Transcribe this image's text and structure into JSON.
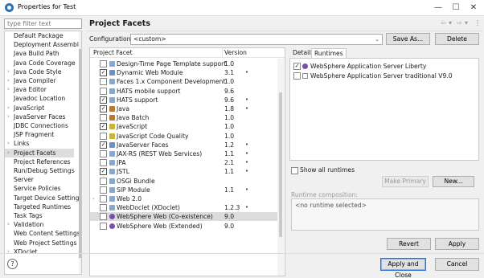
{
  "window": {
    "title": "Properties for Test",
    "minimize": "—",
    "maximize": "☐",
    "close": "✕"
  },
  "filter": {
    "placeholder": "type filter text"
  },
  "nav": [
    {
      "label": "Default Package",
      "chev": false
    },
    {
      "label": "Deployment Assembly",
      "chev": false
    },
    {
      "label": "Java Build Path",
      "chev": false
    },
    {
      "label": "Java Code Coverage",
      "chev": false
    },
    {
      "label": "Java Code Style",
      "chev": true
    },
    {
      "label": "Java Compiler",
      "chev": true
    },
    {
      "label": "Java Editor",
      "chev": true
    },
    {
      "label": "Javadoc Location",
      "chev": false
    },
    {
      "label": "JavaScript",
      "chev": true
    },
    {
      "label": "JavaServer Faces",
      "chev": true
    },
    {
      "label": "JDBC Connections",
      "chev": false
    },
    {
      "label": "JSP Fragment",
      "chev": false
    },
    {
      "label": "Links",
      "chev": true
    },
    {
      "label": "Project Facets",
      "chev": true,
      "selected": true
    },
    {
      "label": "Project References",
      "chev": false
    },
    {
      "label": "Run/Debug Settings",
      "chev": false
    },
    {
      "label": "Server",
      "chev": false
    },
    {
      "label": "Service Policies",
      "chev": false
    },
    {
      "label": "Target Device Settings",
      "chev": false
    },
    {
      "label": "Targeted Runtimes",
      "chev": false
    },
    {
      "label": "Task Tags",
      "chev": false
    },
    {
      "label": "Validation",
      "chev": true
    },
    {
      "label": "Web Content Settings",
      "chev": false
    },
    {
      "label": "Web Project Settings",
      "chev": false
    },
    {
      "label": "XDoclet",
      "chev": true
    }
  ],
  "header": {
    "title": "Project Facets",
    "back": "⇦",
    "back_dd": "▾",
    "fwd": "⇨",
    "fwd_dd": "▾",
    "menu": "⋮"
  },
  "config": {
    "label": "Configuration:",
    "value": "<custom>",
    "dd": "⌄",
    "save_as": "Save As...",
    "delete": "Delete"
  },
  "facets_table": {
    "col_facet": "Project Facet",
    "col_version": "Version",
    "rows": [
      {
        "name": "Design-Time Page Template support",
        "version": "1.0",
        "checked": false,
        "expand": false,
        "dot": false,
        "ico": "#8aa7c8"
      },
      {
        "name": "Dynamic Web Module",
        "version": "3.1",
        "checked": true,
        "expand": false,
        "dot": true,
        "ico": "#6f8fbf"
      },
      {
        "name": "Faces 1.x Component Development",
        "version": "1.0",
        "checked": false,
        "expand": false,
        "dot": false,
        "ico": "#8aa7c8"
      },
      {
        "name": "HATS mobile support",
        "version": "9.6",
        "checked": false,
        "expand": false,
        "dot": false,
        "ico": "#8aa7c8"
      },
      {
        "name": "HATS support",
        "version": "9.6",
        "checked": true,
        "expand": false,
        "dot": true,
        "ico": "#8aa7c8"
      },
      {
        "name": "Java",
        "version": "1.8",
        "checked": true,
        "expand": false,
        "dot": true,
        "ico": "#b37a3b"
      },
      {
        "name": "Java Batch",
        "version": "1.0",
        "checked": false,
        "expand": false,
        "dot": false,
        "ico": "#b37a3b"
      },
      {
        "name": "JavaScript",
        "version": "1.0",
        "checked": true,
        "expand": false,
        "dot": false,
        "ico": "#c9b43a"
      },
      {
        "name": "JavaScript Code Quality",
        "version": "1.0",
        "checked": false,
        "expand": false,
        "dot": false,
        "ico": "#c9b43a"
      },
      {
        "name": "JavaServer Faces",
        "version": "1.2",
        "checked": true,
        "expand": false,
        "dot": true,
        "ico": "#6f8fbf"
      },
      {
        "name": "JAX-RS (REST Web Services)",
        "version": "1.1",
        "checked": false,
        "expand": false,
        "dot": true,
        "ico": "#8aa7c8"
      },
      {
        "name": "JPA",
        "version": "2.1",
        "checked": false,
        "expand": false,
        "dot": true,
        "ico": "#8aa7c8"
      },
      {
        "name": "JSTL",
        "version": "1.1",
        "checked": true,
        "expand": false,
        "dot": true,
        "ico": "#8aa7c8"
      },
      {
        "name": "OSGi Bundle",
        "version": "",
        "checked": false,
        "expand": false,
        "dot": false,
        "ico": "#8aa7c8"
      },
      {
        "name": "SIP Module",
        "version": "1.1",
        "checked": false,
        "expand": false,
        "dot": true,
        "ico": "#8aa7c8"
      },
      {
        "name": "Web 2.0",
        "version": "",
        "checked": false,
        "expand": true,
        "dot": false,
        "ico": "#8aa7c8"
      },
      {
        "name": "WebDoclet (XDoclet)",
        "version": "1.2.3",
        "checked": false,
        "expand": false,
        "dot": true,
        "ico": "#8aa7c8"
      },
      {
        "name": "WebSphere Web (Co-existence)",
        "version": "9.0",
        "checked": false,
        "expand": false,
        "dot": false,
        "ico": "ws",
        "selected": true
      },
      {
        "name": "WebSphere Web (Extended)",
        "version": "9.0",
        "checked": false,
        "expand": false,
        "dot": false,
        "ico": "ws"
      }
    ]
  },
  "tabs": {
    "details": "Details",
    "runtimes": "Runtimes"
  },
  "runtimes": [
    {
      "name": "WebSphere Application Server Liberty",
      "checked": true,
      "ico": "ws"
    },
    {
      "name": "WebSphere Application Server traditional V9.0",
      "checked": false,
      "ico": "doc"
    }
  ],
  "show_all": "Show all runtimes",
  "make_primary": "Make Primary",
  "new_btn": "New...",
  "runtime_composition": {
    "label": "Runtime composition:",
    "value": "<no runtime selected>"
  },
  "revert": "Revert",
  "apply": "Apply",
  "help": "?",
  "apply_close": "Apply and Close",
  "cancel": "Cancel",
  "check_mark": "✓",
  "chev_right": "›",
  "expand_arrow": "›",
  "dot_mark": "•"
}
